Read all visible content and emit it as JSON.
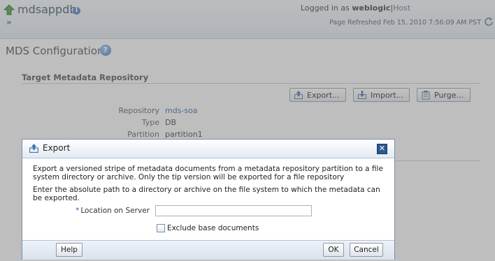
{
  "header": {
    "target_name": "mdsappdb",
    "nav_arrow": "»",
    "logged_in_prefix": "Logged in as",
    "user": "weblogic",
    "separator": "|",
    "host_link": "Host",
    "page_refreshed": "Page Refreshed Feb 15, 2010 7:56:09 AM PST"
  },
  "page": {
    "title": "MDS Configuration",
    "help_glyph": "?",
    "section_title": "Target Metadata Repository",
    "buttons": {
      "export": "Export...",
      "import": "Import...",
      "purge": "Purge..."
    },
    "fields": [
      {
        "label": "Repository",
        "value": "mds-soa"
      },
      {
        "label": "Type",
        "value": "DB"
      },
      {
        "label": "Partition",
        "value": "partition1"
      }
    ]
  },
  "dialog": {
    "title": "Export",
    "close_glyph": "✕",
    "description": "Export a versioned stripe of metadata documents from a metadata repository partition to a file system directory or archive. Only the tip version will be exported for a file repository",
    "instruction": "Enter the absolute path to a directory or archive on the file system to which the metadata can be exported.",
    "location_required_marker": "*",
    "location_label": "Location on Server",
    "location_value": "",
    "exclude_label": "Exclude base documents",
    "exclude_checked": false,
    "help_button": "Help",
    "ok_button": "OK",
    "cancel_button": "Cancel"
  },
  "colors": {
    "link": "#2a5fa0",
    "dialog_border": "#7a8ea6",
    "close_button": "#2b5791"
  }
}
